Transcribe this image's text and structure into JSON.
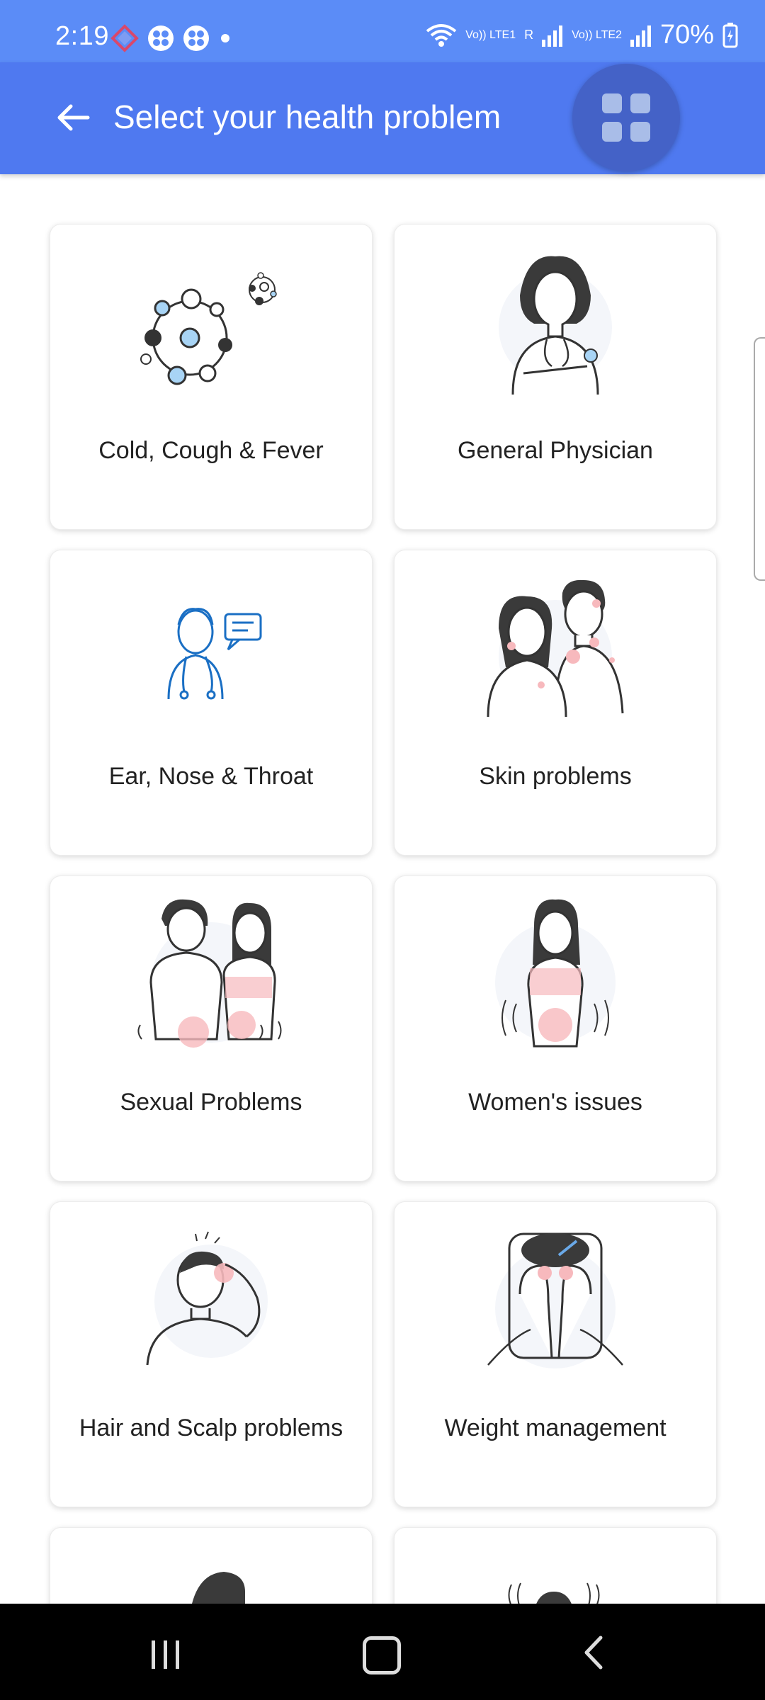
{
  "status_bar": {
    "time": "2:19",
    "battery": "70%",
    "network_1": "Vo)) LTE1",
    "network_2": "Vo)) LTE2",
    "roaming": "R"
  },
  "app_bar": {
    "title": "Select your health problem",
    "back_icon": "arrow-left-icon",
    "menu_icon": "grid-menu-icon"
  },
  "categories": [
    {
      "label": "Cold, Cough & Fever",
      "icon": "virus-icon"
    },
    {
      "label": "General Physician",
      "icon": "doctor-icon"
    },
    {
      "label": "Ear, Nose & Throat",
      "icon": "ent-doctor-icon"
    },
    {
      "label": "Skin problems",
      "icon": "skin-icon"
    },
    {
      "label": "Sexual Problems",
      "icon": "couple-icon"
    },
    {
      "label": "Women's issues",
      "icon": "woman-icon"
    },
    {
      "label": "Hair and Scalp problems",
      "icon": "hair-scalp-icon"
    },
    {
      "label": "Weight management",
      "icon": "scale-icon"
    }
  ],
  "colors": {
    "status_bar": "#5b8cf7",
    "app_bar": "#4f79f0",
    "grid_button": "#4462c7",
    "accent_pink": "#f7b9bd",
    "accent_blue": "#a8d4f5"
  }
}
